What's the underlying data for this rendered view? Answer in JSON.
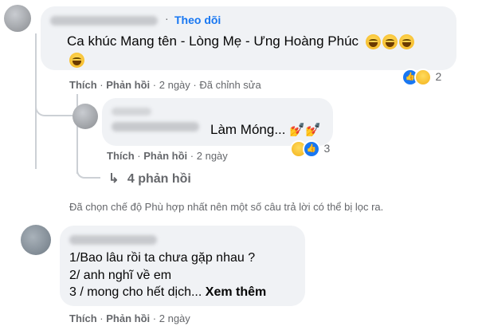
{
  "comment1": {
    "follow_label": "Theo dõi",
    "text": "Ca khúc Mang tên - Lòng Mẹ - Ưng Hoàng Phúc",
    "like_label": "Thích",
    "reply_label": "Phản hồi",
    "time": "2 ngày",
    "edited": "Đã chỉnh sửa",
    "reaction_count": "2",
    "sep": "·"
  },
  "reply1": {
    "text": "Làm Móng...",
    "like_label": "Thích",
    "reply_label": "Phản hồi",
    "time": "2 ngày",
    "reaction_count": "3",
    "sep": "·"
  },
  "more_replies": {
    "label": "4 phản hồi",
    "icon": "reply-arrow-icon"
  },
  "filter_notice": "Đã chọn chế độ Phù hợp nhất nên một số câu trả lời có thể bị lọc ra.",
  "comment2": {
    "line1": "1/Bao lâu rồi ta chưa gặp nhau ?",
    "line2": "2/ anh nghĩ về em",
    "line3": "3 / mong cho hết dịch...",
    "see_more": "Xem thêm",
    "like_label": "Thích",
    "reply_label": "Phản hồi",
    "time": "2 ngày",
    "sep": "·"
  },
  "colors": {
    "link": "#1877f2",
    "bubble": "#f0f2f5",
    "meta": "#65676b"
  }
}
